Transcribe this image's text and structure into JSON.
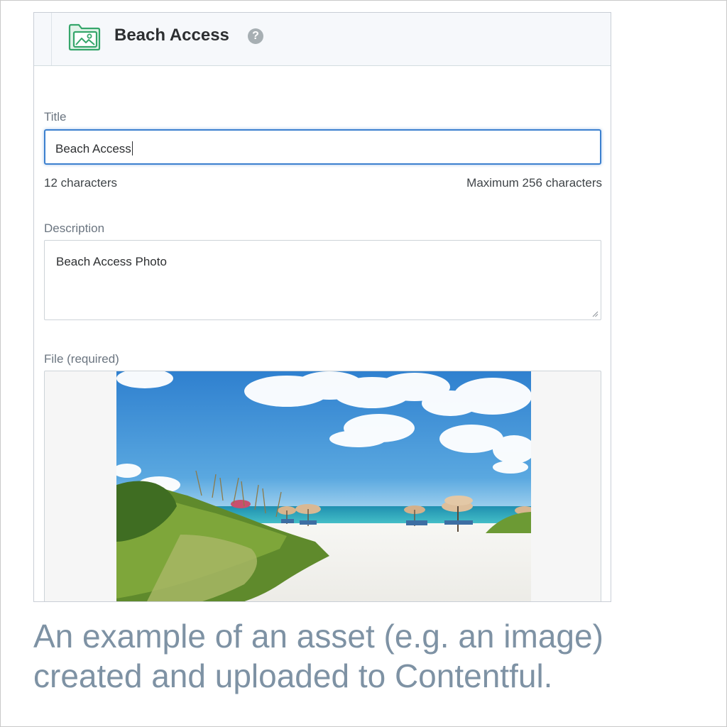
{
  "header": {
    "title": "Beach Access",
    "help_glyph": "?",
    "asset_icon": "image-folder-icon",
    "accent_color": "#36a66b"
  },
  "fields": {
    "title": {
      "label": "Title",
      "value": "Beach Access",
      "count_text": "12 characters",
      "limit_text": "Maximum 256 characters"
    },
    "description": {
      "label": "Description",
      "value": "Beach Access Photo"
    },
    "file": {
      "label": "File (required)",
      "preview_icon": "beach-photo"
    }
  },
  "caption": {
    "line1": "An example of an asset (e.g. an image)",
    "line2": "created and uploaded to Contentful."
  }
}
